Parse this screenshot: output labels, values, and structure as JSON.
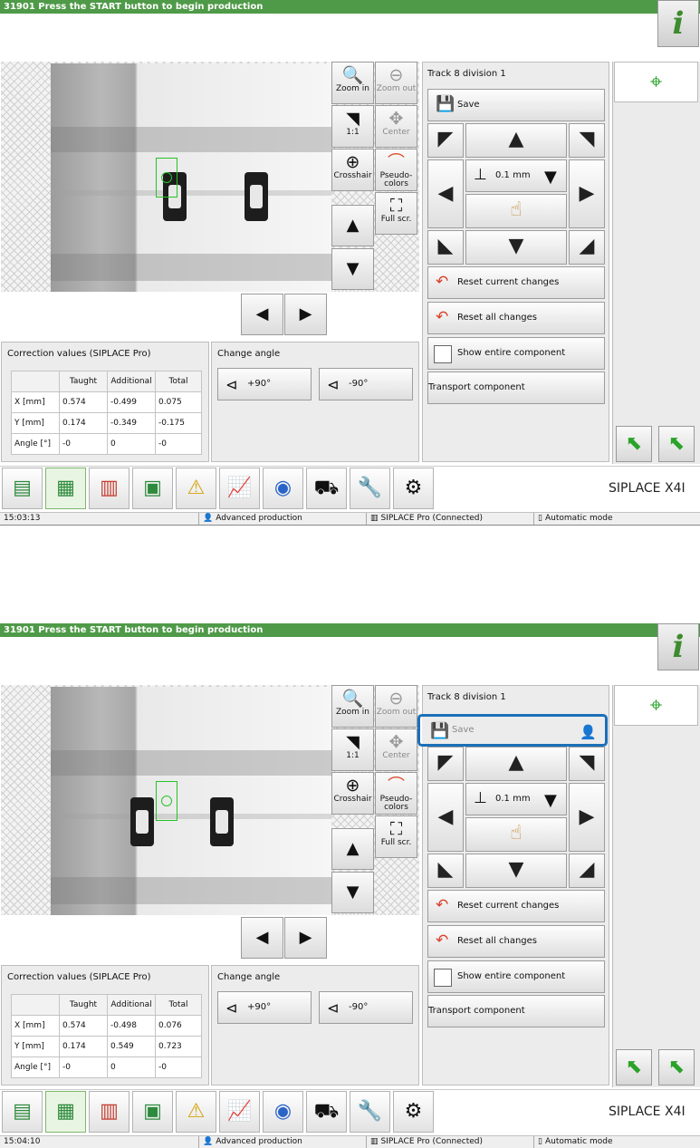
{
  "screens": [
    {
      "title": "31901 Press the START button to begin production",
      "info_button": "i",
      "toolbar": {
        "zoom_in": "Zoom in",
        "zoom_out": "Zoom out",
        "one_to_one": "1:1",
        "center": "Center",
        "crosshair": "Crosshair",
        "pseudo_colors": "Pseudo-colors",
        "full_screen": "Full scr."
      },
      "panel": {
        "title": "Track 8 division 1",
        "save": "Save",
        "step": "0.1 mm",
        "reset_current": "Reset current changes",
        "reset_all": "Reset all changes",
        "show_entire": "Show entire component",
        "transport": "Transport component"
      },
      "correction": {
        "title": "Correction values (SIPLACE Pro)",
        "headers": [
          "",
          "Taught",
          "Additional",
          "Total"
        ],
        "rows": [
          [
            "X [mm]",
            "0.574",
            "-0.499",
            "0.075"
          ],
          [
            "Y [mm]",
            "0.174",
            "-0.349",
            "-0.175"
          ],
          [
            "Angle [°]",
            "-0",
            "0",
            "-0"
          ]
        ]
      },
      "change_angle": {
        "title": "Change angle",
        "plus": "+90°",
        "minus": "-90°"
      },
      "brand": "SIPLACE X4I",
      "status": {
        "time": "15:03:13",
        "mode_user": "Advanced production",
        "connection": "SIPLACE Pro (Connected)",
        "operation": "Automatic mode"
      }
    },
    {
      "title": "31901 Press the START button to begin production",
      "info_button": "i",
      "toolbar": {
        "zoom_in": "Zoom in",
        "zoom_out": "Zoom out",
        "one_to_one": "1:1",
        "center": "Center",
        "crosshair": "Crosshair",
        "pseudo_colors": "Pseudo-colors",
        "full_screen": "Full scr."
      },
      "panel": {
        "title": "Track 8 division 1",
        "save": "Save",
        "step": "0.1 mm",
        "reset_current": "Reset current changes",
        "reset_all": "Reset all changes",
        "show_entire": "Show entire component",
        "transport": "Transport component"
      },
      "correction": {
        "title": "Correction values (SIPLACE Pro)",
        "headers": [
          "",
          "Taught",
          "Additional",
          "Total"
        ],
        "rows": [
          [
            "X [mm]",
            "0.574",
            "-0.498",
            "0.076"
          ],
          [
            "Y [mm]",
            "0.174",
            "0.549",
            "0.723"
          ],
          [
            "Angle [°]",
            "-0",
            "0",
            "-0"
          ]
        ]
      },
      "change_angle": {
        "title": "Change angle",
        "plus": "+90°",
        "minus": "-90°"
      },
      "brand": "SIPLACE X4I",
      "status": {
        "time": "15:04:10",
        "mode_user": "Advanced production",
        "connection": "SIPLACE Pro (Connected)",
        "operation": "Automatic mode"
      }
    }
  ],
  "colors": {
    "titlebar": "#4f9a48",
    "accent_green": "#29a329",
    "highlight": "#1b6fb8"
  }
}
